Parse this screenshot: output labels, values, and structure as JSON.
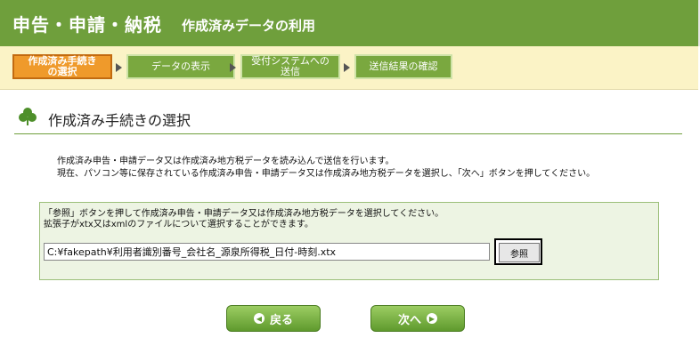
{
  "header": {
    "app_title": "申告・申請・納税",
    "page_title": "作成済みデータの利用"
  },
  "steps": [
    {
      "label": "作成済み手続き\nの選択",
      "active": true
    },
    {
      "label": "データの表示",
      "active": false
    },
    {
      "label": "受付システムへの\n送信",
      "active": false
    },
    {
      "label": "送信結果の確認",
      "active": false
    }
  ],
  "section": {
    "title": "作成済み手続きの選択"
  },
  "description": {
    "line1": "作成済み申告・申請データ又は作成済み地方税データを読み込んで送信を行います。",
    "line2": "現在、パソコン等に保存されている作成済み申告・申請データ又は作成済み地方税データを選択し、「次へ」ボタンを押してください。"
  },
  "file_box": {
    "note1": "「参照」ボタンを押して作成済み申告・申請データ又は作成済み地方税データを選択してください。",
    "note2": "拡張子がxtx又はxmlのファイルについて選択することができます。",
    "path_value": "C:¥fakepath¥利用者識別番号_会社名_源泉所得税_日付-時刻.xtx",
    "browse_label": "参照"
  },
  "buttons": {
    "back_label": "戻る",
    "next_label": "次へ"
  },
  "colors": {
    "header": "#6f9f3c",
    "active_step": "#ef9a2b",
    "step": "#7aa83f",
    "steps_bg": "#fbf3c6"
  }
}
